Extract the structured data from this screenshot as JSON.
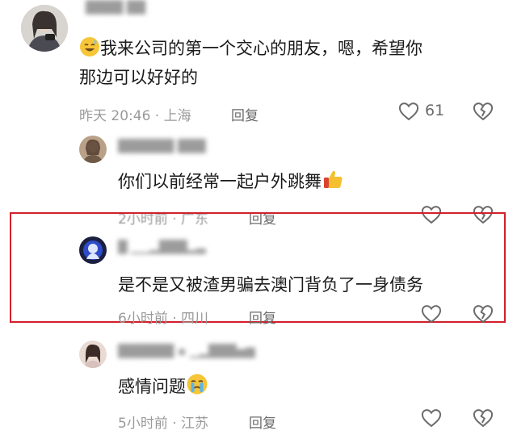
{
  "comments": [
    {
      "text_line1": "我来公司的第一个交心的朋友，嗯，希望你",
      "text_line2": "那边可以好好的",
      "emoji": "sweat-smile-emoji",
      "meta": "昨天 20:46 · 上海",
      "reply": "回复",
      "likes": "61"
    },
    {
      "text": "你们以前经常一起户外跳舞",
      "emoji": "thumbs-up-emoji",
      "meta": "2小时前 · 广东",
      "reply": "回复"
    },
    {
      "text": "是不是又被渣男骗去澳门背负了一身债务",
      "meta": "6小时前 · 四川",
      "reply": "回复"
    },
    {
      "text": "感情问题",
      "emoji": "crying-emoji",
      "meta": "5小时前 · 江苏",
      "reply": "回复"
    }
  ],
  "colors": {
    "highlight_border": "#d21f2b",
    "meta_text": "#9a9a9a",
    "body_text": "#1a1a1a"
  },
  "icons": [
    "heart-icon",
    "broken-heart-icon"
  ]
}
